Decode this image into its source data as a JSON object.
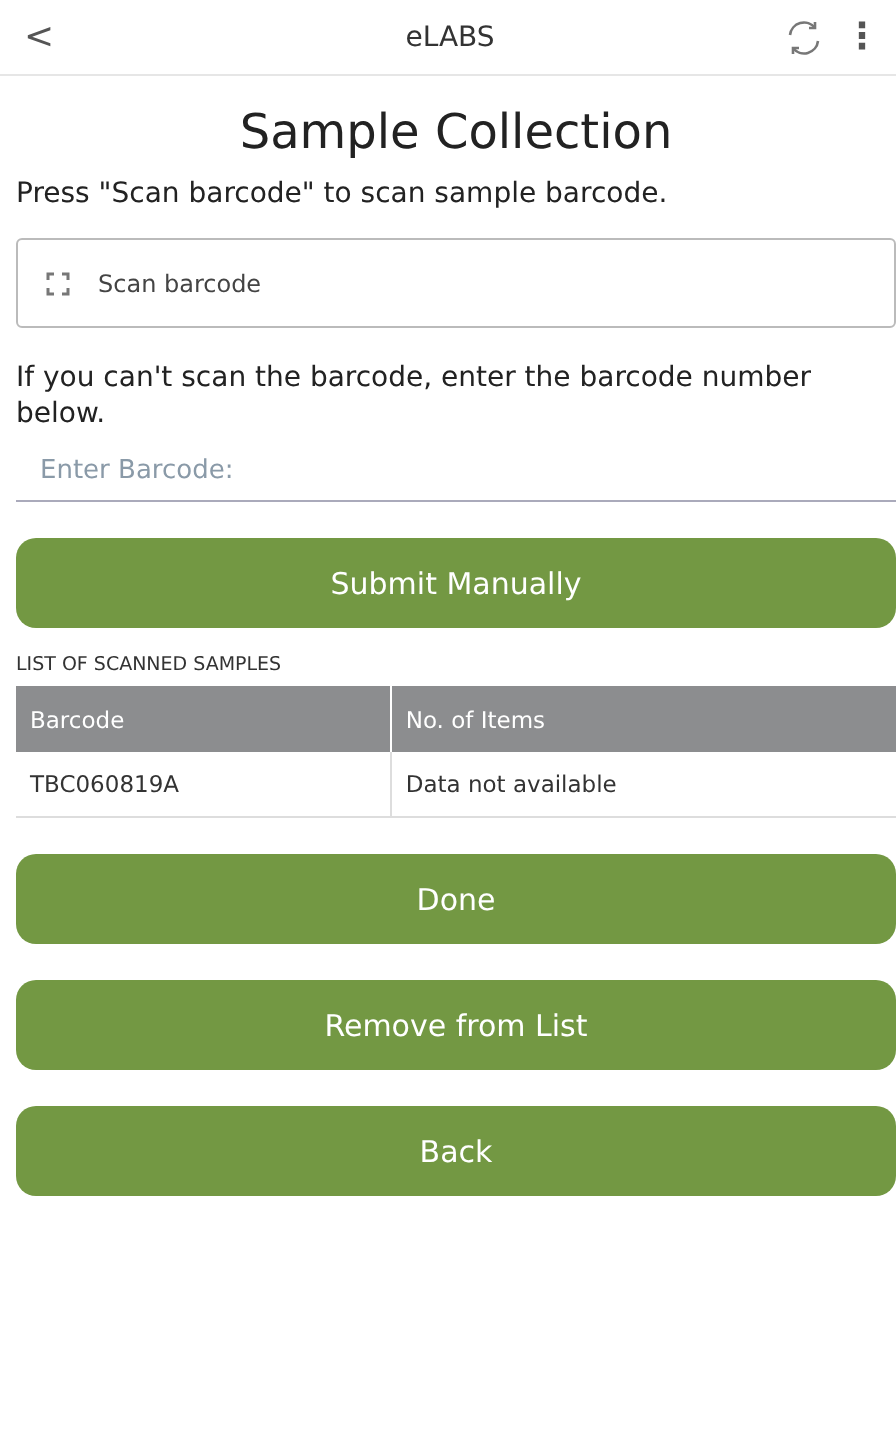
{
  "header": {
    "back": "<",
    "title": "eLABS",
    "menu": "⋮"
  },
  "page_title": "Sample Collection",
  "scan_instruction": "Press \"Scan barcode\" to scan sample barcode.",
  "scan_button": "Scan barcode",
  "manual_instruction": "If you can't scan the barcode, enter the barcode number below.",
  "barcode_field": {
    "placeholder": "Enter Barcode:"
  },
  "submit_button": "Submit Manually",
  "list_label": "LIST OF SCANNED SAMPLES",
  "table": {
    "columns": [
      "Barcode",
      "No. of Items"
    ],
    "rows": [
      [
        "TBC060819A",
        "Data not available"
      ]
    ]
  },
  "buttons": [
    "Done",
    "Remove from List",
    "Back"
  ]
}
